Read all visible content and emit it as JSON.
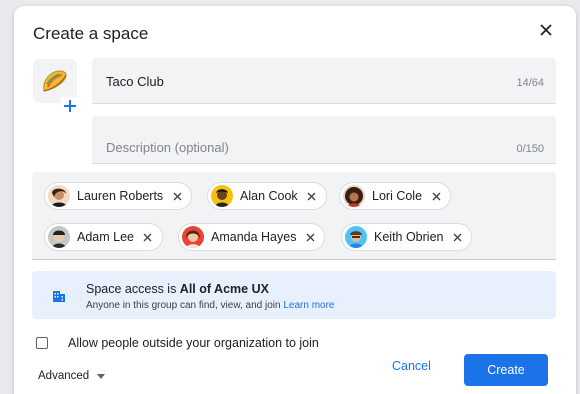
{
  "dialog": {
    "title": "Create a space",
    "close_icon": "close-icon"
  },
  "emoji": {
    "icon": "taco-emoji-icon",
    "add_icon": "plus-icon"
  },
  "name_field": {
    "value": "Taco Club",
    "counter": "14/64"
  },
  "description_field": {
    "placeholder": "Description (optional)",
    "counter": "0/150"
  },
  "members": [
    {
      "name": "Lauren Roberts",
      "avatar_color": "#8d5a3c"
    },
    {
      "name": "Alan Cook",
      "avatar_color": "#f4c20d"
    },
    {
      "name": "Lori Cole",
      "avatar_color": "#6d3b1e"
    },
    {
      "name": "Adam Lee",
      "avatar_color": "#9aa0a6"
    },
    {
      "name": "Amanda Hayes",
      "avatar_color": "#ea4335"
    },
    {
      "name": "Keith Obrien",
      "avatar_color": "#4fc3f7"
    }
  ],
  "access": {
    "prefix": "Space access is ",
    "group": "All of Acme UX",
    "description": "Anyone in this group can find, view, and join ",
    "learn_more": "Learn more",
    "icon": "building-icon"
  },
  "external_checkbox": {
    "label": "Allow people outside your organization to join",
    "checked": false
  },
  "advanced": {
    "label": "Advanced"
  },
  "actions": {
    "cancel": "Cancel",
    "create": "Create"
  },
  "colors": {
    "accent": "#1a73e8",
    "field_bg": "#f1f3f4",
    "access_bg": "#e8f0fe"
  }
}
